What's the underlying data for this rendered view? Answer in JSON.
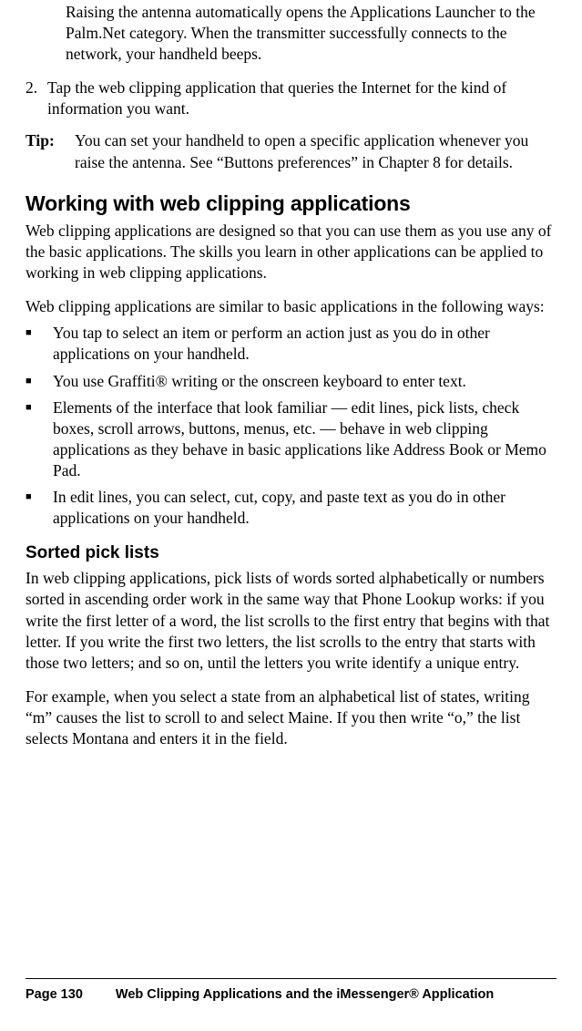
{
  "intro_indented": "Raising the antenna automatically opens the Applications Launcher to the Palm.Net category. When the transmitter successfully connects to the network, your handheld beeps.",
  "step2_num": "2.",
  "step2_text": "Tap the web clipping application that queries the Internet for the kind of information you want.",
  "tip_label": "Tip:",
  "tip_text": "You can set your handheld to open a specific application whenever you raise the antenna. See “Buttons preferences” in Chapter 8 for details.",
  "h2": "Working with web clipping applications",
  "p1": "Web clipping applications are designed so that you can use them as you use any of the basic applications. The skills you learn in other applications can be applied to working in web clipping applications.",
  "p2": "Web clipping applications are similar to basic applications in the following ways:",
  "bullets": [
    "You tap to select an item or perform an action just as you do in other applications on your handheld.",
    "You use Graffiti® writing or the onscreen keyboard to enter text.",
    "Elements of the interface that look familiar — edit lines, pick lists, check boxes, scroll arrows, buttons, menus, etc. — behave in web clipping applications as they behave in basic applications like Address Book or Memo Pad.",
    "In edit lines, you can select, cut, copy, and paste text as you do in other applications on your handheld."
  ],
  "h3": "Sorted pick lists",
  "p3": "In web clipping applications, pick lists of words sorted alphabetically or numbers sorted in ascending order work in the same way that Phone Lookup works: if you write the first letter of a word, the list scrolls to the first entry that begins with that letter. If you write the first two letters, the list scrolls to the entry that starts with those two letters; and so on, until the letters you write identify a unique entry.",
  "p4": "For example, when you select a state from an alphabetical list of states, writing “m” causes the list to scroll to and select Maine. If you then write “o,” the list selects Montana and enters it in the field.",
  "footer_page": "Page 130",
  "footer_title": "Web Clipping Applications and the iMessenger® Application"
}
